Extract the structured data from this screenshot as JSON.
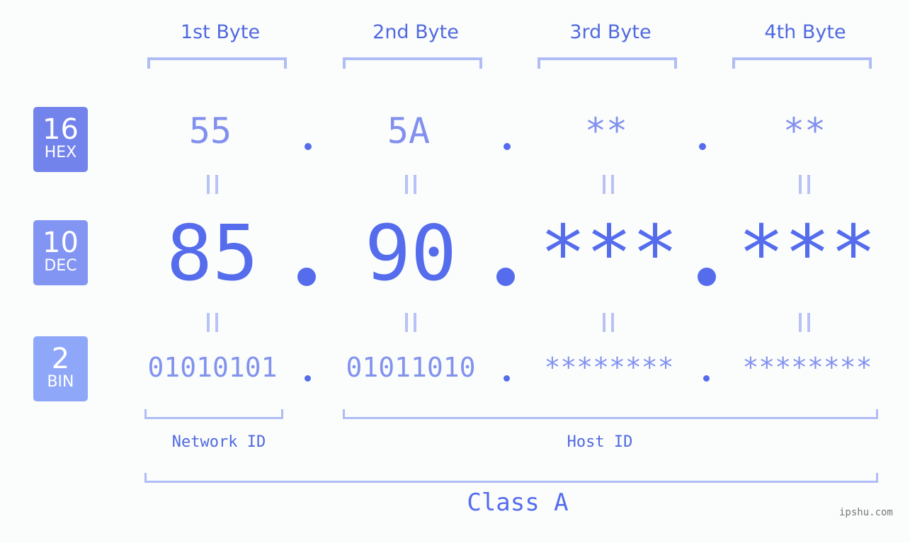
{
  "bytes": [
    {
      "label": "1st Byte",
      "hex": "55",
      "dec": "85",
      "bin": "01010101"
    },
    {
      "label": "2nd Byte",
      "hex": "5A",
      "dec": "90",
      "bin": "01011010"
    },
    {
      "label": "3rd Byte",
      "hex": "**",
      "dec": "***",
      "bin": "********"
    },
    {
      "label": "4th Byte",
      "hex": "**",
      "dec": "***",
      "bin": "********"
    }
  ],
  "bases": {
    "hex": {
      "num": "16",
      "label": "HEX",
      "color": "#7383ec"
    },
    "dec": {
      "num": "10",
      "label": "DEC",
      "color": "#8395f2"
    },
    "bin": {
      "num": "2",
      "label": "BIN",
      "color": "#8fa7f8"
    }
  },
  "separator": ".",
  "network_id_label": "Network ID",
  "host_id_label": "Host ID",
  "class_label": "Class A",
  "watermark": "ipshu.com",
  "colors": {
    "primary": "#556cec",
    "light": "#8190ee",
    "bracket": "#b0bcf6",
    "background": "#fbfdfc"
  }
}
